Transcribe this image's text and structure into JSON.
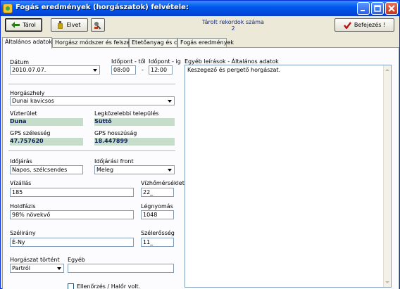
{
  "window": {
    "title": "Fogás eredmények (horgászatok) felvétele:"
  },
  "toolbar": {
    "save_label": "Tárol",
    "discard_label": "Elvet",
    "record_count_label": "Tárolt rekordok száma",
    "record_count": "2",
    "finish_label": "Befejezés !"
  },
  "tabs": [
    {
      "label": "Általános adatok"
    },
    {
      "label": "Horgász módszer és felszerelés"
    },
    {
      "label": "Etetőanyag és csali"
    },
    {
      "label": "Fogás eredmények"
    }
  ],
  "form": {
    "date_label": "Dátum",
    "date_value": "2010.07.07.",
    "time_from_label": "Időpont - től",
    "time_from_value": "08:00",
    "time_dash": "-",
    "time_to_label": "Időpont - ig",
    "time_to_value": "12:00",
    "fishing_place_label": "Horgászhely",
    "fishing_place_value": "Dunai kavicsos",
    "water_label": "Vízterület",
    "water_value": "Duna",
    "settlement_label": "Legközelebbi település",
    "settlement_value": "Süttő",
    "gps_lat_label": "GPS szélesség",
    "gps_lat_value": "47.757620",
    "gps_lon_label": "GPS hosszúság",
    "gps_lon_value": "18.447899",
    "weather_label": "Időjárás",
    "weather_value": "Napos, szélcsendes",
    "front_label": "Időjárási front",
    "front_value": "Meleg",
    "water_level_label": "Vízállás",
    "water_level_value": "185",
    "water_temp_label": "Vízhőmérséklet",
    "water_temp_value": "22_",
    "moon_label": "Holdfázis",
    "moon_value": "98% növekvő",
    "pressure_label": "Légnyomás",
    "pressure_value": "1048",
    "wind_dir_label": "Szélirány",
    "wind_dir_value": "É-Ny",
    "wind_strength_label": "Szélerősség",
    "wind_strength_value": "11_",
    "fishing_from_label": "Horgászat történt",
    "fishing_from_value": "Partról",
    "other_label": "Egyéb",
    "other_value": "",
    "check_label": "Ellenőrzés / Halőr volt."
  },
  "notes": {
    "label": "Egyéb leírások - Általános adatok",
    "value": "Keszegező és pergető horgászat."
  },
  "colors": {
    "titlebar": "#0058ee",
    "readonly_bg": "#c5ddca",
    "readonly_text": "#10205a"
  }
}
